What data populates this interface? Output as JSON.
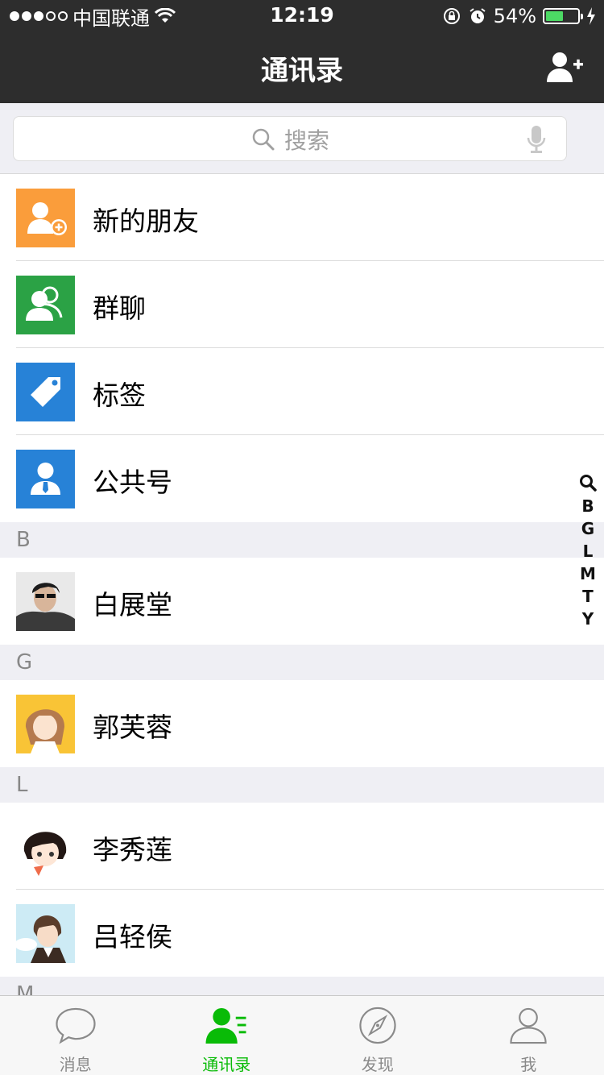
{
  "status_bar": {
    "carrier": "中国联通",
    "time": "12:19",
    "battery_percent": "54%",
    "battery_level": 0.54,
    "signal_full_dots": 3,
    "signal_total_dots": 5
  },
  "nav": {
    "title": "通讯录",
    "add_icon": "add-friend-icon"
  },
  "search": {
    "placeholder": "搜索"
  },
  "functions": [
    {
      "label": "新的朋友",
      "icon": "new-friend-icon",
      "color": "#fa9d3b"
    },
    {
      "label": "群聊",
      "icon": "group-chat-icon",
      "color": "#2ba245"
    },
    {
      "label": "标签",
      "icon": "tag-icon",
      "color": "#2782d7"
    },
    {
      "label": "公共号",
      "icon": "official-account-icon",
      "color": "#2782d7"
    }
  ],
  "sections": [
    {
      "letter": "B",
      "contacts": [
        {
          "name": "白展堂"
        }
      ]
    },
    {
      "letter": "G",
      "contacts": [
        {
          "name": "郭芙蓉"
        }
      ]
    },
    {
      "letter": "L",
      "contacts": [
        {
          "name": "李秀莲"
        },
        {
          "name": "吕轻侯"
        }
      ]
    },
    {
      "letter": "M",
      "contacts": []
    }
  ],
  "index_bar": [
    "B",
    "G",
    "L",
    "M",
    "T",
    "Y"
  ],
  "tabs": [
    {
      "label": "消息",
      "icon": "chat-bubble-icon",
      "active": false
    },
    {
      "label": "通讯录",
      "icon": "contacts-icon",
      "active": true
    },
    {
      "label": "发现",
      "icon": "compass-icon",
      "active": false
    },
    {
      "label": "我",
      "icon": "profile-icon",
      "active": false
    }
  ],
  "colors": {
    "bar_bg": "#2d2d2d",
    "accent_green": "#09bb07",
    "section_bg": "#efeff4"
  }
}
